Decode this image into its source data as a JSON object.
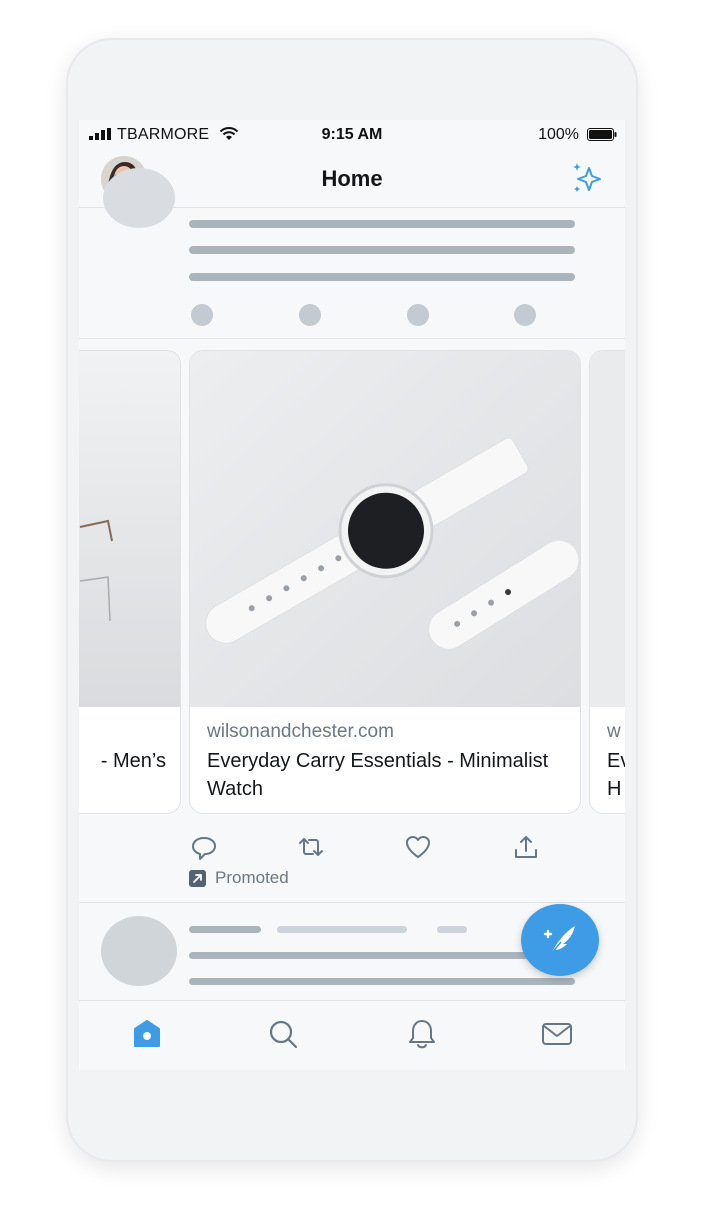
{
  "status_bar": {
    "carrier": "TBARMORE",
    "time": "9:15 AM",
    "battery": "100%"
  },
  "header": {
    "title": "Home",
    "avatar_icon": "profile-avatar",
    "action_icon": "sparkle-icon"
  },
  "carousel": {
    "cards": [
      {
        "domain": "",
        "title": "- Men’s"
      },
      {
        "domain": "wilsonandchester.com",
        "title": "Everyday Carry Essentials - Minimalist Watch"
      },
      {
        "domain": "w",
        "title": "Ev\nH"
      }
    ]
  },
  "tweet_actions": {
    "reply_icon": "reply-icon",
    "retweet_icon": "retweet-icon",
    "like_icon": "heart-icon",
    "share_icon": "share-icon",
    "promoted_label": "Promoted"
  },
  "tab_bar": {
    "items": [
      "home-icon",
      "search-icon",
      "notifications-icon",
      "messages-icon"
    ],
    "active": "home-icon"
  },
  "colors": {
    "accent": "#3e9be6",
    "placeholder": "#aab4bd"
  }
}
